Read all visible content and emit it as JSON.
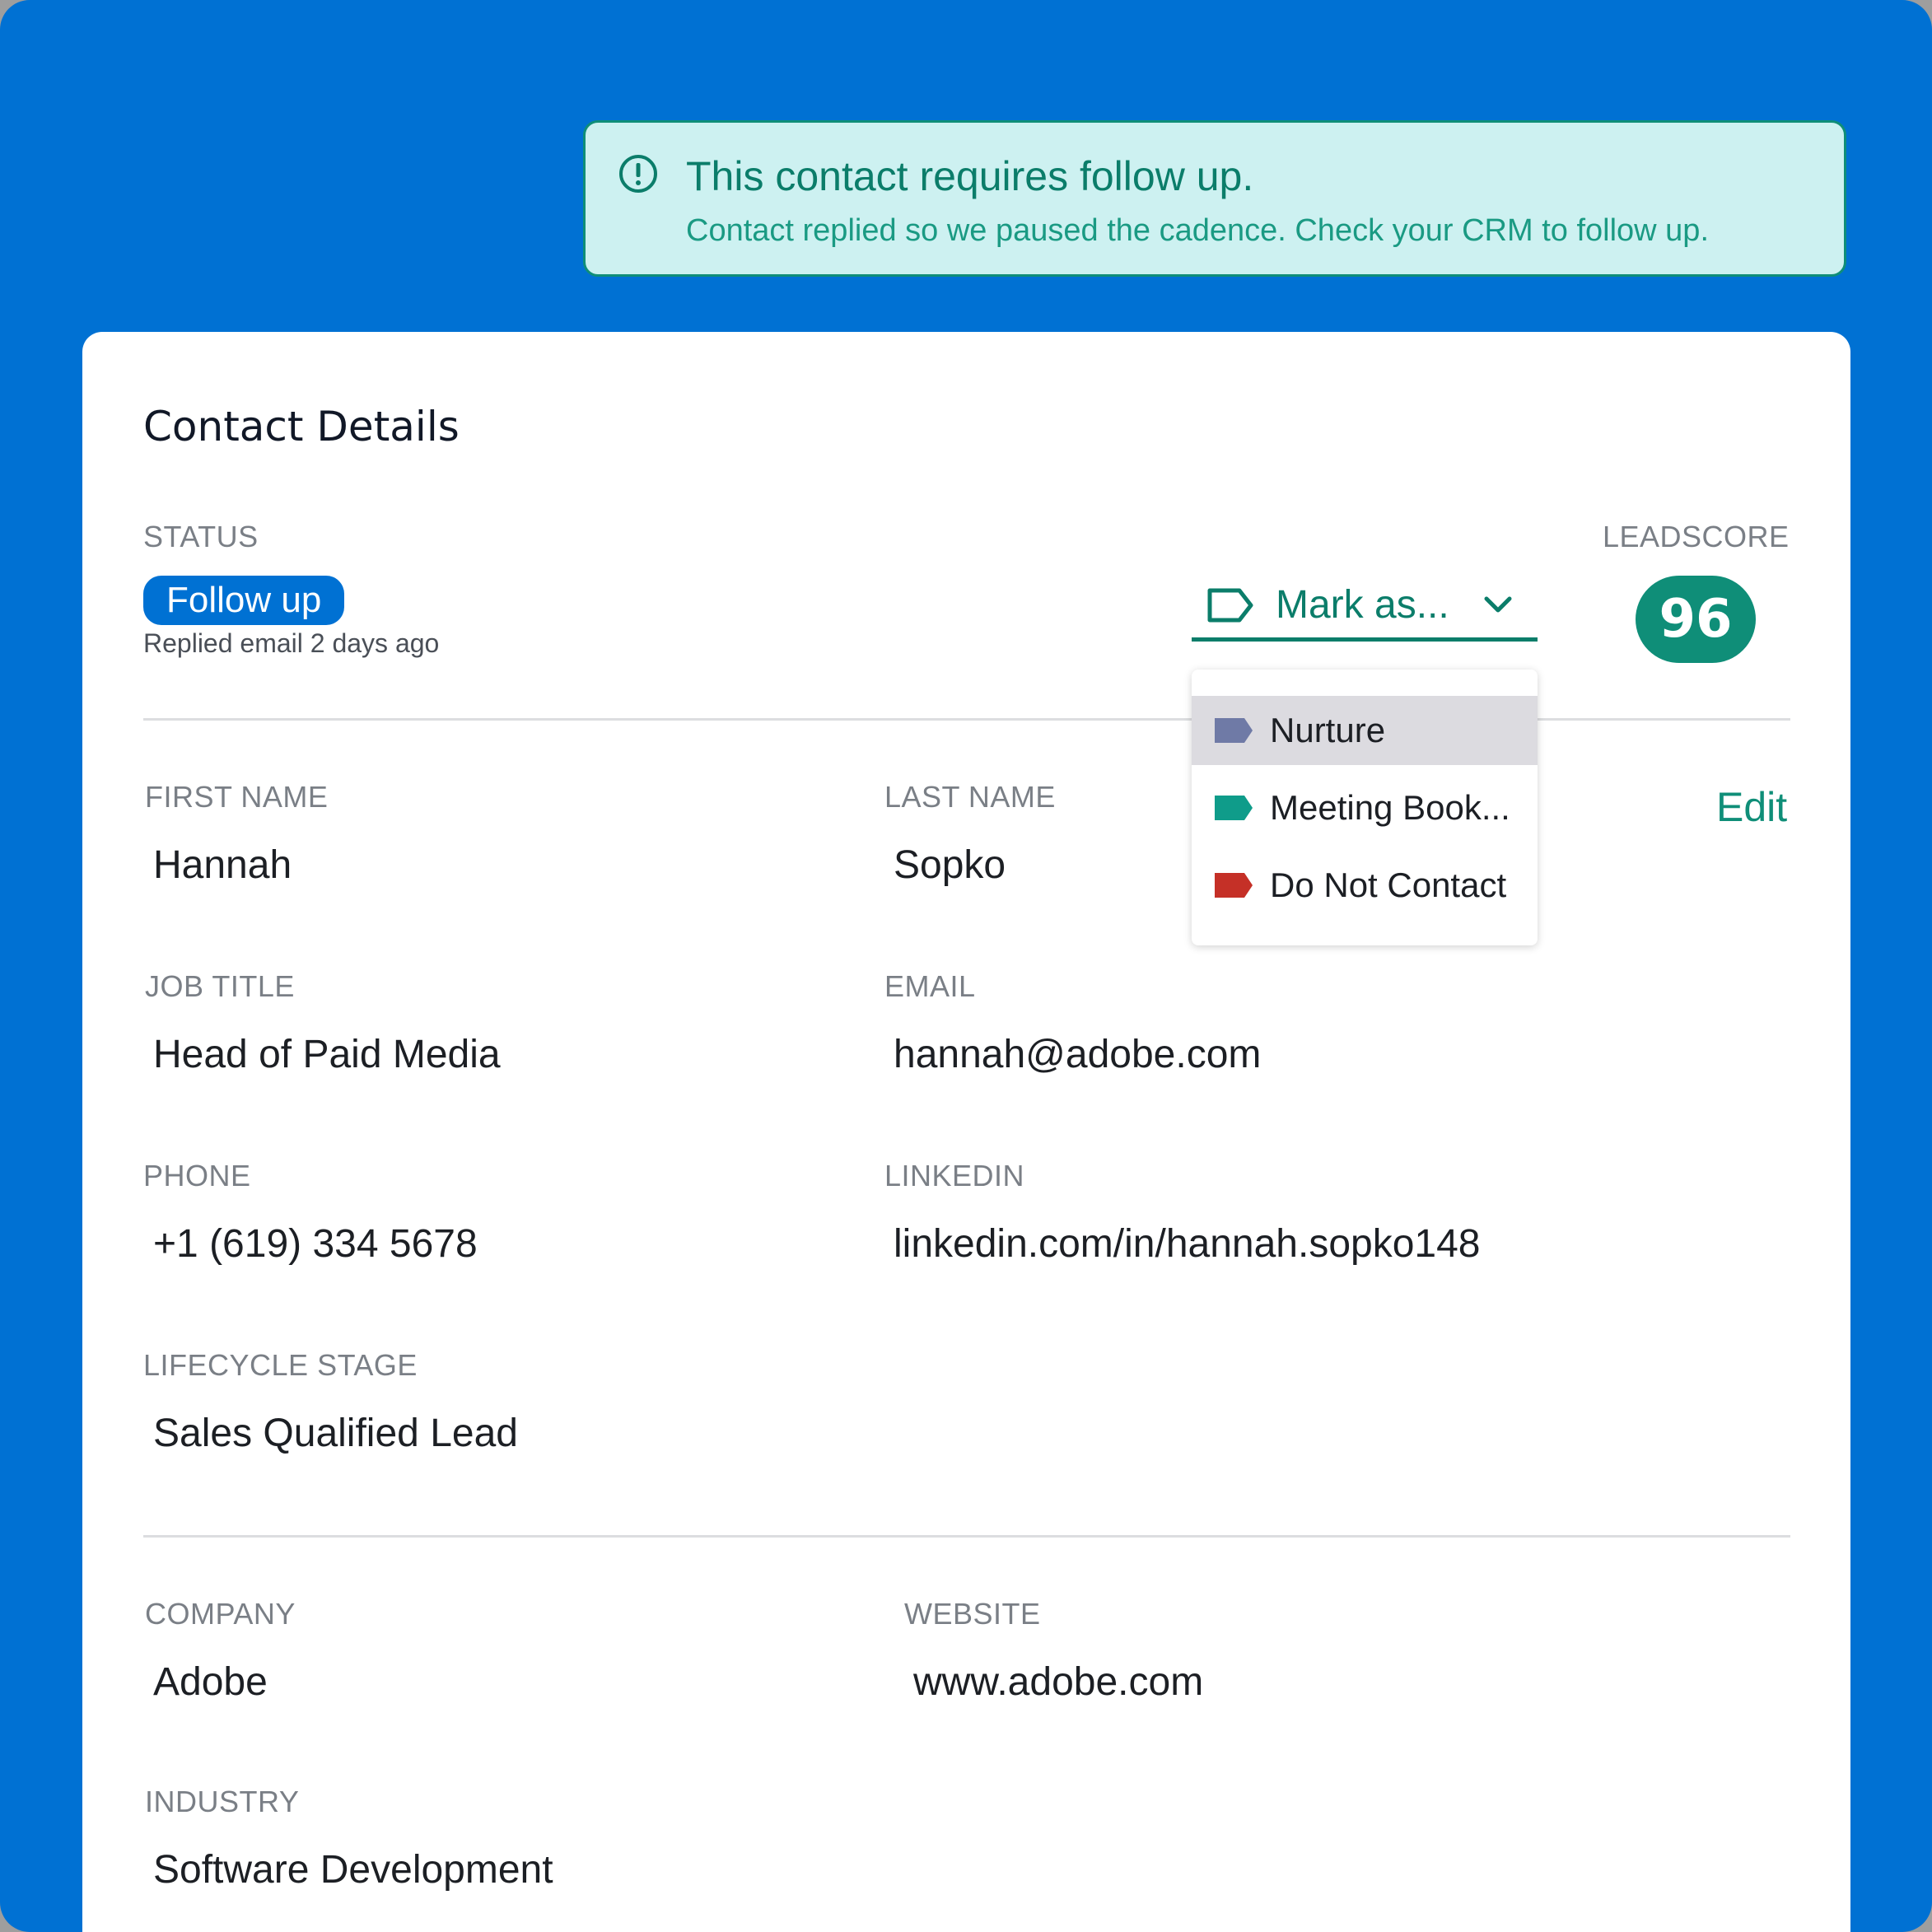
{
  "banner": {
    "title": "This contact requires follow up.",
    "subtitle": "Contact replied so we paused the cadence. Check your CRM to follow up.",
    "icon": "alert-circle-icon"
  },
  "card": {
    "title": "Contact Details",
    "status_label": "STATUS",
    "status_value": "Follow up",
    "status_sub": "Replied email 2 days ago",
    "mark_as": {
      "label": "Mark as...",
      "icon": "tag-outline-icon",
      "chevron": "chevron-down-icon"
    },
    "leadscore_label": "LEADSCORE",
    "leadscore_value": "96",
    "edit_label": "Edit",
    "dropdown_options": [
      {
        "label": "Nurture",
        "color": "#6f7aa6",
        "highlighted": true
      },
      {
        "label": "Meeting Book...",
        "color": "#0f9c8a",
        "highlighted": false
      },
      {
        "label": "Do Not Contact",
        "color": "#c53027",
        "highlighted": false
      }
    ],
    "fields": {
      "first_name": {
        "label": "FIRST NAME",
        "value": "Hannah"
      },
      "last_name": {
        "label": "LAST NAME",
        "value": "Sopko"
      },
      "job_title": {
        "label": "JOB TITLE",
        "value": "Head of Paid Media"
      },
      "email": {
        "label": "EMAIL",
        "value": "hannah@adobe.com"
      },
      "phone": {
        "label": "PHONE",
        "value": "+1 (619) 334 5678"
      },
      "linkedin": {
        "label": "LINKEDIN",
        "value": "linkedin.com/in/hannah.sopko148"
      },
      "lifecycle_stage": {
        "label": "LIFECYCLE STAGE",
        "value": "Sales Qualified Lead"
      },
      "company": {
        "label": "COMPANY",
        "value": "Adobe"
      },
      "website": {
        "label": "WEBSITE",
        "value": "www.adobe.com"
      },
      "industry": {
        "label": "INDUSTRY",
        "value": "Software Development"
      }
    }
  },
  "colors": {
    "background": "#0071d3",
    "accent": "#0f8e78",
    "banner_bg": "#cdf1f1"
  }
}
